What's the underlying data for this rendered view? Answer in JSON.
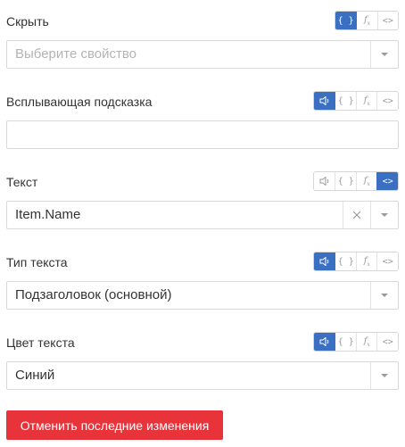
{
  "fields": {
    "hide": {
      "label": "Скрыть",
      "placeholder": "Выберите свойство",
      "value": "",
      "modes": [
        "{ }",
        "fx",
        "<>"
      ],
      "active_mode": "{ }"
    },
    "tooltip": {
      "label": "Всплывающая подсказка",
      "value": "",
      "modes": [
        "speaker",
        "{ }",
        "fx",
        "<>"
      ],
      "active_mode": "speaker"
    },
    "text": {
      "label": "Текст",
      "value": "Item.Name",
      "modes": [
        "speaker",
        "{ }",
        "fx",
        "<>"
      ],
      "active_mode": "<>"
    },
    "text_type": {
      "label": "Тип текста",
      "value": "Подзаголовок (основной)",
      "modes": [
        "speaker",
        "{ }",
        "fx",
        "<>"
      ],
      "active_mode": "speaker"
    },
    "text_color": {
      "label": "Цвет текста",
      "value": "Синий",
      "modes": [
        "speaker",
        "{ }",
        "fx",
        "<>"
      ],
      "active_mode": "speaker"
    }
  },
  "reset_button": {
    "label": "Отменить последние изменения",
    "color": "#e8333a"
  },
  "colors": {
    "accent": "#3b6fc2",
    "border": "#d9d9d9"
  }
}
